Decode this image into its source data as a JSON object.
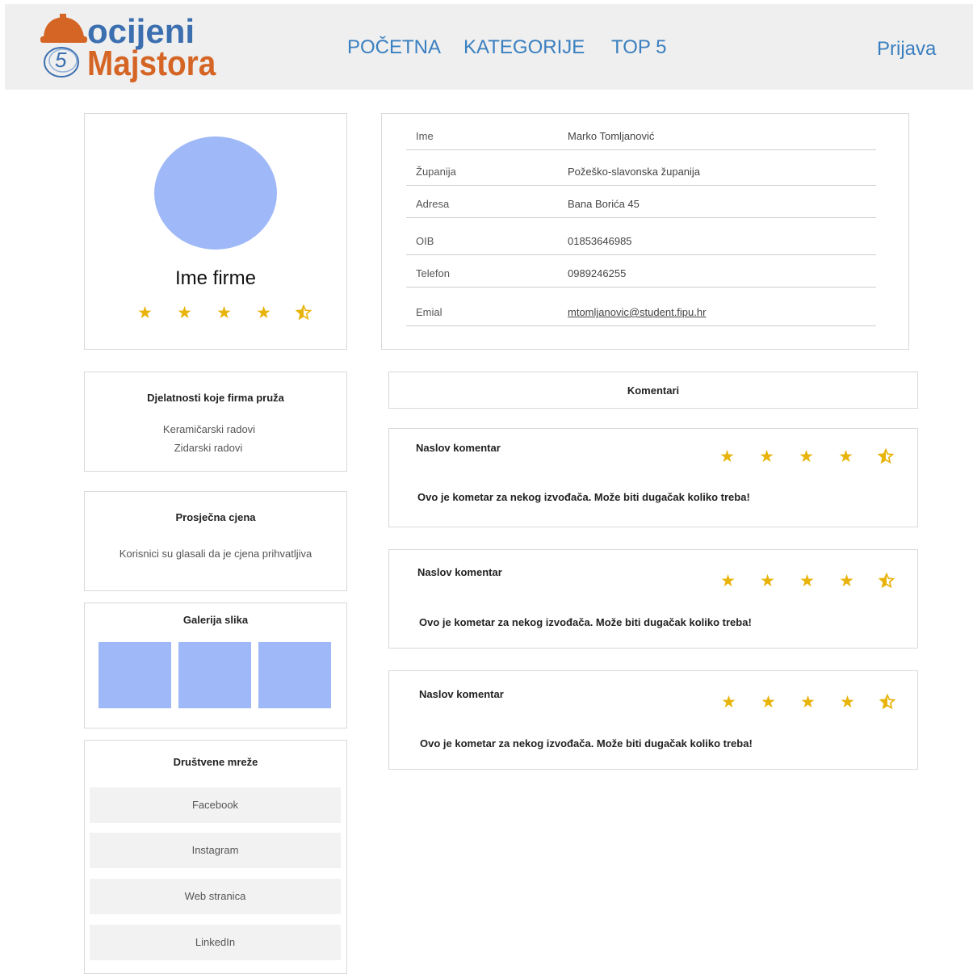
{
  "brand": {
    "logo_top": "ocijeni",
    "logo_bottom": "Majstora",
    "logo_number": "5",
    "colors": {
      "blue": "#3b6fb0",
      "orange": "#d56524"
    }
  },
  "nav": {
    "items": [
      "POČETNA",
      "KATEGORIJE",
      "TOP 5"
    ],
    "login": "Prijava"
  },
  "profile": {
    "firm_name": "Ime firme",
    "rating_stars": 4.5
  },
  "info": {
    "rows": [
      {
        "label": "Ime",
        "value": "Marko Tomljanović"
      },
      {
        "label": "Županija",
        "value": "Požeško-slavonska županija"
      },
      {
        "label": "Adresa",
        "value": "Bana Borića 45"
      },
      {
        "label": "OIB",
        "value": "01853646985"
      },
      {
        "label": "Telefon",
        "value": "0989246255"
      },
      {
        "label": "Emial",
        "value": "mtomljanovic@student.fipu.hr"
      }
    ]
  },
  "activities": {
    "title": "Djelatnosti koje firma pruža",
    "items": [
      "Keramičarski radovi",
      "Zidarski radovi"
    ]
  },
  "price": {
    "title": "Prosječna cjena",
    "text": "Korisnici su glasali da je cjena prihvatljiva"
  },
  "gallery": {
    "title": "Galerija slika"
  },
  "social": {
    "title": "Društvene mreže",
    "items": [
      "Facebook",
      "Instagram",
      "Web stranica",
      "LinkedIn"
    ]
  },
  "comments": {
    "header": "Komentari",
    "items": [
      {
        "title": "Naslov komentar",
        "text": "Ovo je kometar za nekog izvođača. Može biti dugačak koliko treba!",
        "rating_stars": 4.5
      },
      {
        "title": "Naslov komentar",
        "text": "Ovo je kometar za nekog izvođača. Može biti dugačak koliko treba!",
        "rating_stars": 4.5
      },
      {
        "title": "Naslov komentar",
        "text": "Ovo je kometar za nekog izvođača. Može biti dugačak koliko treba!",
        "rating_stars": 4.5
      }
    ]
  },
  "icons": {
    "full_star": "star-icon",
    "half_star": "half-star-icon",
    "logo": "hard-hat-icon"
  }
}
